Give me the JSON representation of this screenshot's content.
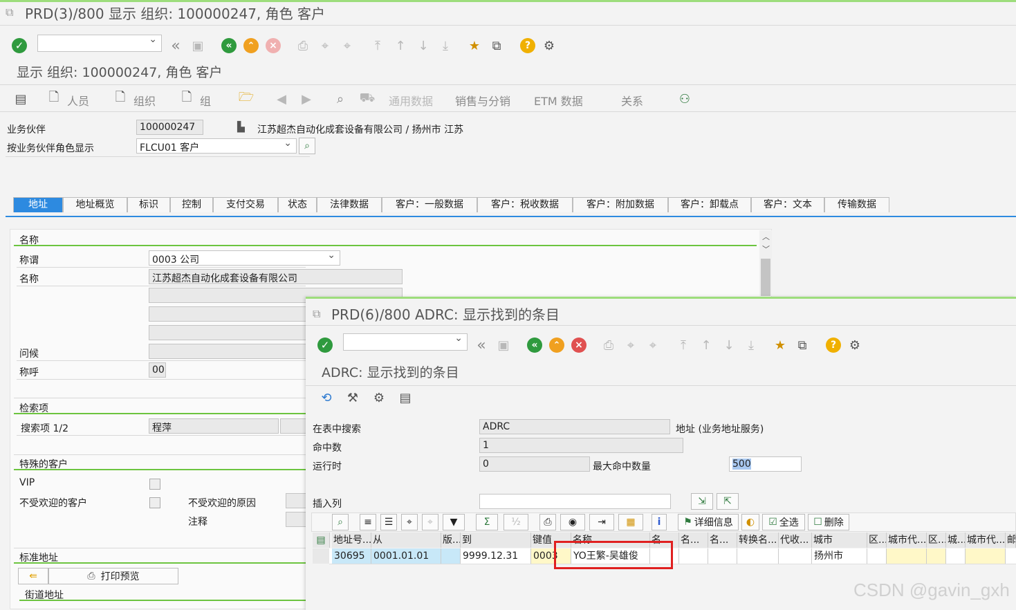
{
  "main_window": {
    "title": "PRD(3)/800 显示 组织: 100000247, 角色 客户",
    "subtitle": "显示 组织: 100000247, 角色 客户",
    "toolbar_icons": [
      "check-icon",
      "command-field",
      "back-double-icon",
      "save-icon",
      "back-icon",
      "exit-icon",
      "cancel-icon",
      "print-icon",
      "find-icon",
      "find-next-icon",
      "first-page-icon",
      "prev-page-icon",
      "next-page-icon",
      "last-page-icon",
      "new-session-icon",
      "shortcut-icon",
      "help-icon",
      "settings-icon"
    ],
    "app_toolbar": {
      "person": "人员",
      "organization": "组织",
      "group": "组",
      "general_data": "通用数据",
      "sales_distribution": "销售与分销",
      "etm_data": "ETM 数据",
      "relationships": "关系"
    },
    "header": {
      "partner_label": "业务伙伴",
      "partner_value": "100000247",
      "partner_desc": "江苏超杰自动化成套设备有限公司 / 扬州市 江苏",
      "role_label": "按业务伙伴角色显示",
      "role_value": "FLCU01 客户"
    },
    "tabs": [
      "地址",
      "地址概览",
      "标识",
      "控制",
      "支付交易",
      "状态",
      "法律数据",
      "客户：一般数据",
      "客户：税收数据",
      "客户：附加数据",
      "客户：卸载点",
      "客户：文本",
      "传输数据"
    ],
    "name_section": {
      "heading": "名称",
      "title_label": "称谓",
      "title_value": "0003 公司",
      "name_label": "名称",
      "name_value": "江苏超杰自动化成套设备有限公司",
      "greeting_label": "问候",
      "salutation_label": "称呼",
      "salutation_value": "00"
    },
    "search_section": {
      "heading": "检索项",
      "search_label": "搜索项 1/2",
      "search_value": "程萍"
    },
    "special_section": {
      "heading": "特殊的客户",
      "vip_label": "VIP",
      "unwanted_label": "不受欢迎的客户",
      "reason_label": "不受欢迎的原因",
      "note_label": "注释"
    },
    "address_section": {
      "heading": "标准地址",
      "print_preview": "打印预览",
      "street_label": "街道地址"
    }
  },
  "popup": {
    "title": "PRD(6)/800 ADRC:  显示找到的条目",
    "subtitle": "ADRC:  显示找到的条目",
    "table_search_label": "在表中搜索",
    "table_search_value": "ADRC",
    "table_desc": "地址 (业务地址服务)",
    "hits_label": "命中数",
    "hits_value": "1",
    "runtime_label": "运行时",
    "runtime_value": "0",
    "max_hits_label": "最大命中数量",
    "max_hits_value": "500",
    "insert_col_label": "插入列",
    "details_label": "详细信息",
    "select_all_label": "全选",
    "delete_label": "删除",
    "columns": [
      "地址号...",
      "从",
      "版...",
      "到",
      "键值",
      "名称",
      "名",
      "名...",
      "名...",
      "转换名...",
      "代收...",
      "城市",
      "区...",
      "城市代...",
      "区...",
      "城...",
      "城市代...",
      "邮"
    ],
    "row": {
      "addr_no": "30695",
      "from": "0001.01.01",
      "to": "9999.12.31",
      "key": "0003",
      "name": "YO王繁-吴雄俊",
      "city": "扬州市"
    }
  },
  "watermark": "CSDN @gavin_gxh",
  "colors": {
    "accent_green": "#6cc43f",
    "tab_active": "#2d8ae0",
    "highlight_red": "#e02020",
    "cell_yellow": "#fff8c8",
    "cell_blue": "#c8e8f8"
  }
}
